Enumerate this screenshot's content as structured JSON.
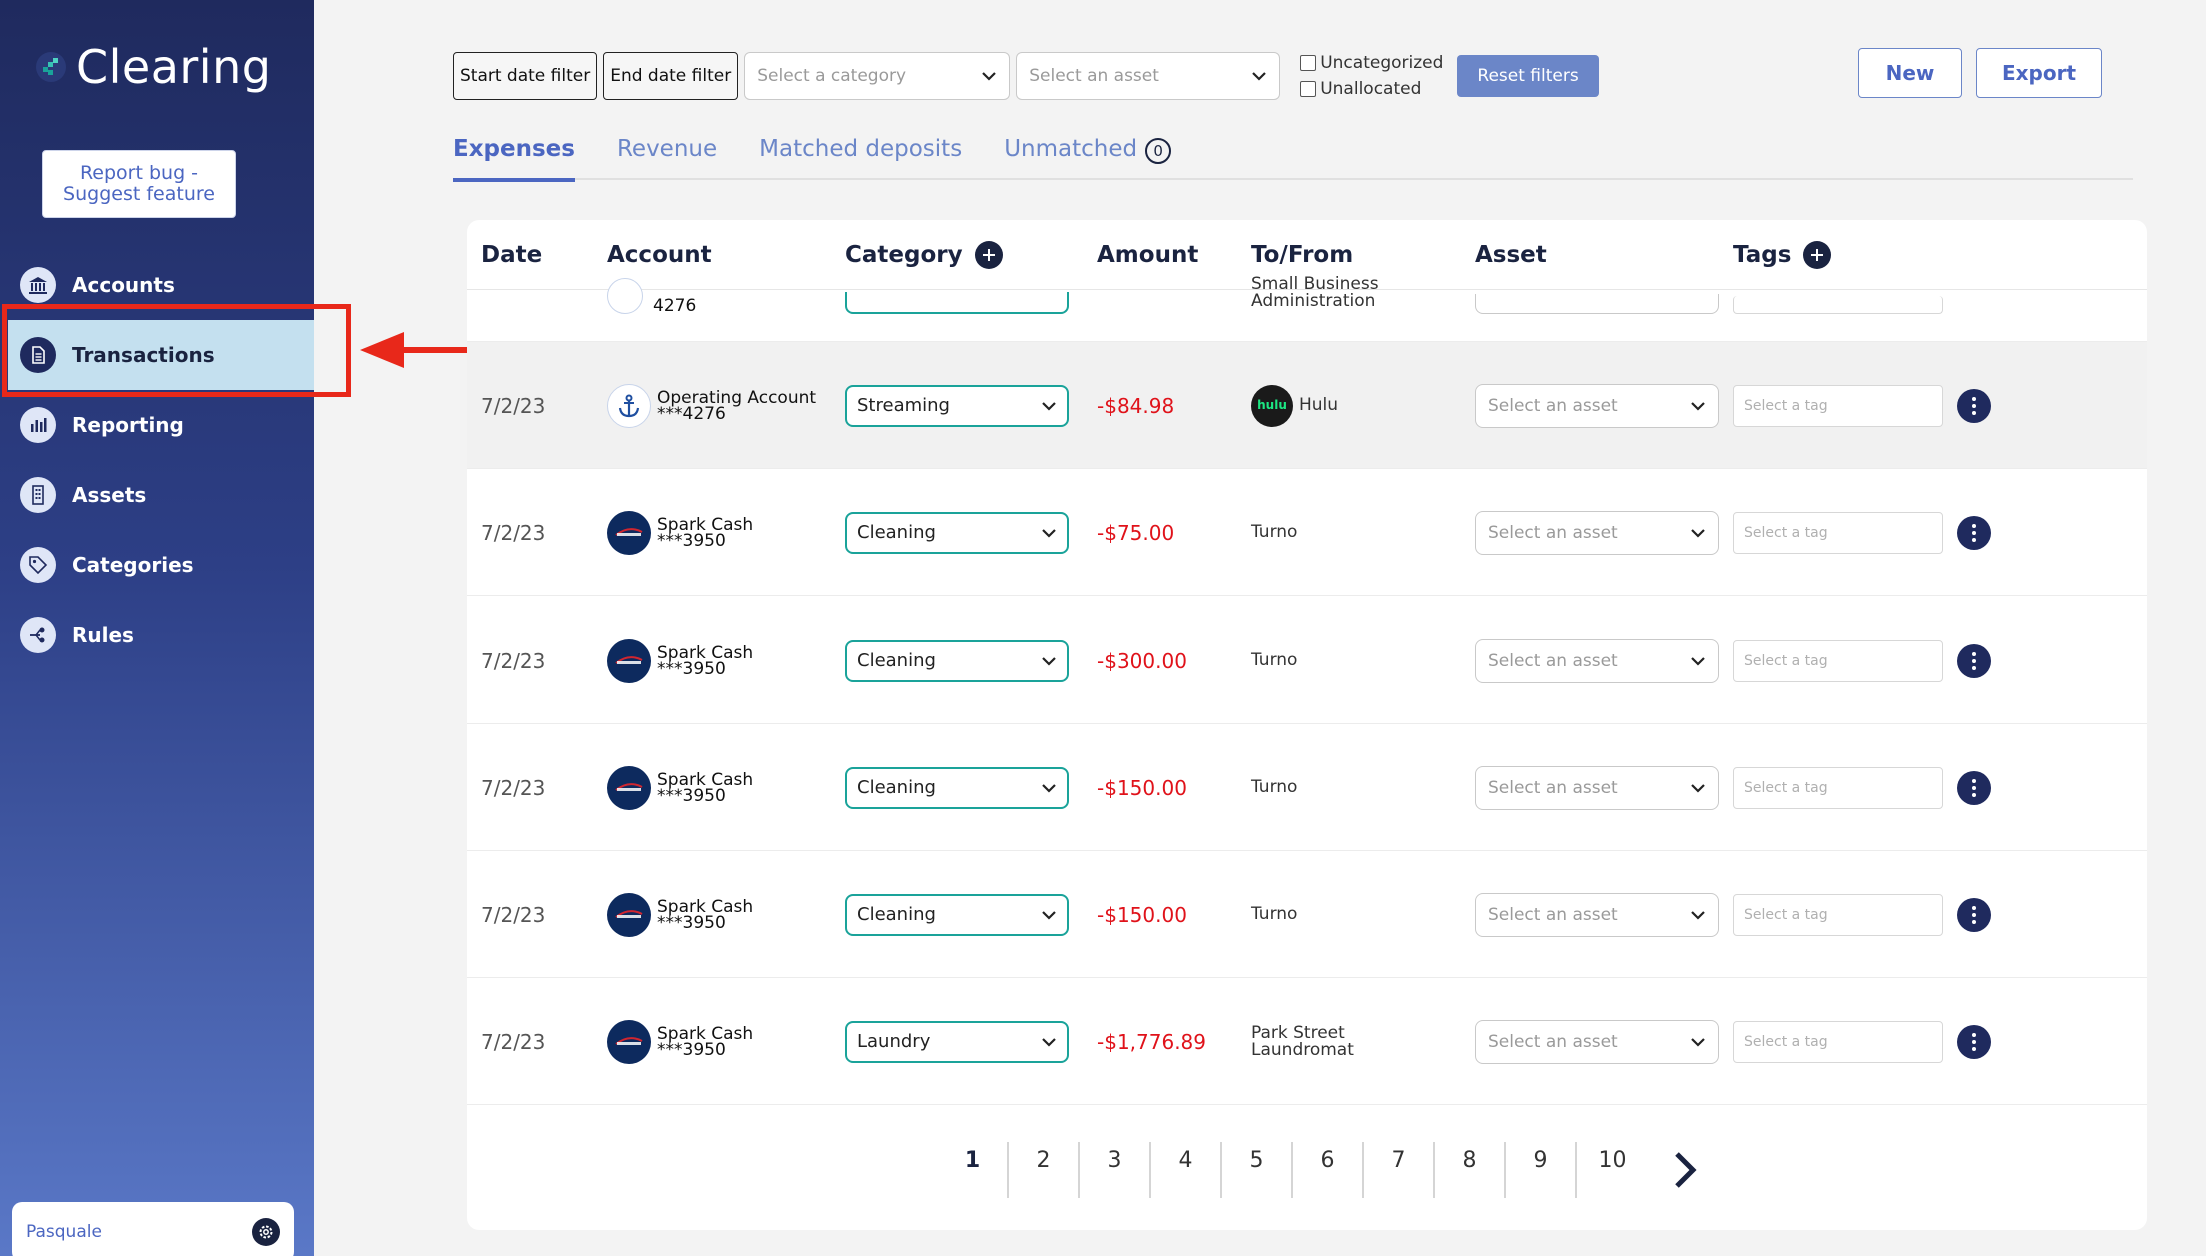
{
  "app": {
    "name": "Clearing"
  },
  "sidebar": {
    "report_button": "Report bug -\nSuggest feature",
    "items": [
      {
        "label": "Accounts",
        "icon": "bank-icon",
        "active": false
      },
      {
        "label": "Transactions",
        "icon": "document-icon",
        "active": true
      },
      {
        "label": "Reporting",
        "icon": "bar-chart-icon",
        "active": false
      },
      {
        "label": "Assets",
        "icon": "building-icon",
        "active": false
      },
      {
        "label": "Categories",
        "icon": "tag-icon",
        "active": false
      },
      {
        "label": "Rules",
        "icon": "rules-icon",
        "active": false
      }
    ],
    "user_name": "Pasquale"
  },
  "toolbar": {
    "start_date": "Start date filter",
    "end_date": "End date filter",
    "category_placeholder": "Select a category",
    "asset_placeholder": "Select an asset",
    "uncategorized": "Uncategorized",
    "unallocated": "Unallocated",
    "reset": "Reset filters",
    "new": "New",
    "export": "Export"
  },
  "tabs": [
    {
      "label": "Expenses",
      "active": true
    },
    {
      "label": "Revenue",
      "active": false
    },
    {
      "label": "Matched deposits",
      "active": false
    },
    {
      "label": "Unmatched",
      "active": false,
      "count": "0"
    }
  ],
  "table": {
    "headers": {
      "date": "Date",
      "account": "Account",
      "category": "Category",
      "amount": "Amount",
      "tofrom": "To/From",
      "asset": "Asset",
      "tags": "Tags"
    },
    "asset_placeholder": "Select an asset",
    "tag_placeholder": "Select a tag",
    "partial_row": {
      "account_suffix": "4276",
      "tofrom": "Small Business\nAdministration"
    },
    "rows": [
      {
        "date": "7/2/23",
        "account_name": "Operating Account",
        "account_num": "***4276",
        "account_type": "operating",
        "category": "Streaming",
        "amount": "-$84.98",
        "tofrom": "Hulu",
        "tofrom_logo": "hulu"
      },
      {
        "date": "7/2/23",
        "account_name": "Spark Cash",
        "account_num": "***3950",
        "account_type": "capital-one",
        "category": "Cleaning",
        "amount": "-$75.00",
        "tofrom": "Turno"
      },
      {
        "date": "7/2/23",
        "account_name": "Spark Cash",
        "account_num": "***3950",
        "account_type": "capital-one",
        "category": "Cleaning",
        "amount": "-$300.00",
        "tofrom": "Turno"
      },
      {
        "date": "7/2/23",
        "account_name": "Spark Cash",
        "account_num": "***3950",
        "account_type": "capital-one",
        "category": "Cleaning",
        "amount": "-$150.00",
        "tofrom": "Turno"
      },
      {
        "date": "7/2/23",
        "account_name": "Spark Cash",
        "account_num": "***3950",
        "account_type": "capital-one",
        "category": "Cleaning",
        "amount": "-$150.00",
        "tofrom": "Turno"
      },
      {
        "date": "7/2/23",
        "account_name": "Spark Cash",
        "account_num": "***3950",
        "account_type": "capital-one",
        "category": "Laundry",
        "amount": "-$1,776.89",
        "tofrom": "Park Street\nLaundromat"
      }
    ]
  },
  "pagination": {
    "pages": [
      "1",
      "2",
      "3",
      "4",
      "5",
      "6",
      "7",
      "8",
      "9",
      "10"
    ],
    "current": "1"
  },
  "colors": {
    "sidebar_top": "#1f2a5e",
    "sidebar_bottom": "#5a78c7",
    "accent": "#4b66c1",
    "teal": "#1aa39a",
    "negative": "#e0121a",
    "annotation": "#e8281a"
  }
}
